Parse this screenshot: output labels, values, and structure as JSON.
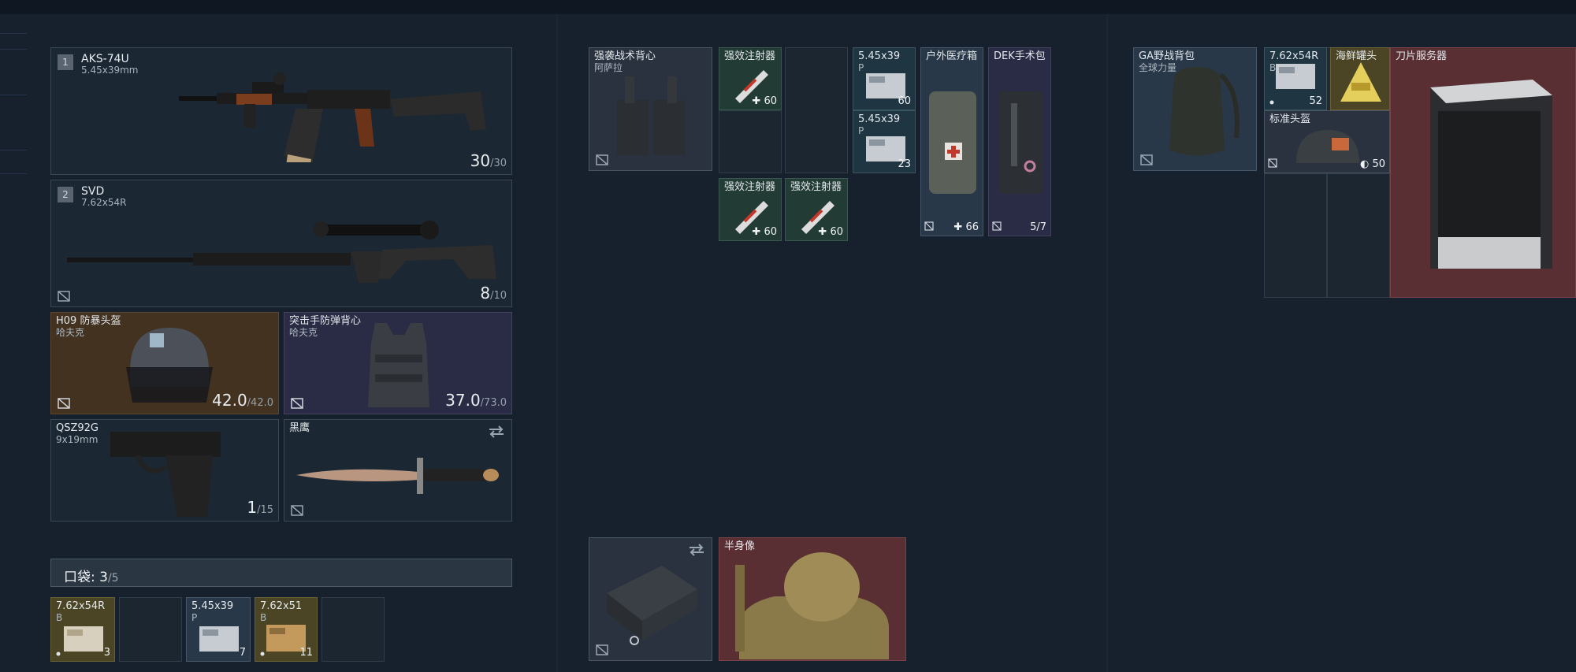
{
  "equipment": {
    "primary1": {
      "index": "1",
      "name": "AKS-74U",
      "caliber": "5.45x39mm",
      "ammo": "30",
      "ammo_max": "/30"
    },
    "primary2": {
      "index": "2",
      "name": "SVD",
      "caliber": "7.62x54R",
      "ammo": "8",
      "ammo_max": "/10"
    },
    "helmet": {
      "name": "H09 防暴头盔",
      "sub": "哈夫克",
      "durability": "42.0",
      "durability_max": "/42.0"
    },
    "armor": {
      "name": "突击手防弹背心",
      "sub": "哈夫克",
      "durability": "37.0",
      "durability_max": "/73.0"
    },
    "pistol": {
      "name": "QSZ92G",
      "caliber": "9x19mm",
      "ammo": "1",
      "ammo_max": "/15"
    },
    "melee": {
      "name": "黑鹰"
    }
  },
  "pockets": {
    "label": "口袋: ",
    "count": "3",
    "max": "/5",
    "items": [
      {
        "name": "7.62x54R",
        "sub": "B",
        "count": "3"
      },
      {
        "name": "5.45x39",
        "sub": "P",
        "count": "7"
      },
      {
        "name": "7.62x51",
        "sub": "B",
        "count": "11"
      }
    ]
  },
  "rig": {
    "name": "强袭战术背心",
    "sub": "阿萨拉",
    "stim1": {
      "name": "强效注射器",
      "stat": "60"
    },
    "stim2": {
      "name": "强效注射器",
      "stat": "60"
    },
    "stim3": {
      "name": "强效注射器",
      "stat": "60"
    },
    "ammo1": {
      "name": "5.45x39",
      "sub": "P",
      "count": "60"
    },
    "ammo2": {
      "name": "5.45x39",
      "sub": "P",
      "count": "23"
    },
    "medkit": {
      "name": "户外医疗箱",
      "stat": "66"
    },
    "surgery": {
      "name": "DEK手术包",
      "stat": "5/7"
    }
  },
  "secure_case": {},
  "bust": {
    "name": "半身像"
  },
  "backpack": {
    "name": "GA野战背包",
    "sub": "全球力量",
    "ammo": {
      "name": "7.62x54R",
      "sub": "B",
      "count": "52"
    },
    "seafood": {
      "name": "海鲜罐头"
    },
    "helmet": {
      "name": "标准头盔",
      "stat": "50"
    },
    "server": {
      "name": "刀片服务器"
    }
  },
  "colors": {
    "background": "#16212d",
    "slot_border": "#3a4856",
    "red_rarity": "#5a2f33",
    "purple_rarity": "#2a2b44",
    "brown_rarity": "#43321f"
  }
}
